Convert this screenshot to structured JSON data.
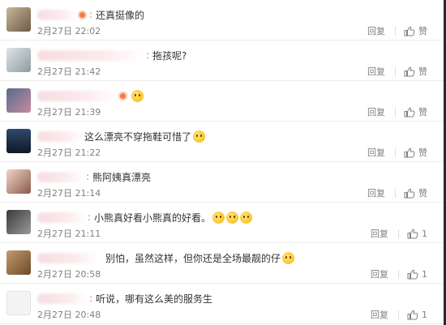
{
  "comments": [
    {
      "id": 1,
      "text": "还真挺像的",
      "time": "2月27日 22:02",
      "reply": "回复",
      "like": "赞"
    },
    {
      "id": 2,
      "text": "拖孩呢?",
      "time": "2月27日 21:42",
      "reply": "回复",
      "like": "赞"
    },
    {
      "id": 3,
      "text": "",
      "time": "2月27日 21:39",
      "reply": "回复",
      "like": "赞"
    },
    {
      "id": 4,
      "text": "这么漂亮不穿拖鞋可惜了",
      "time": "2月27日 21:22",
      "reply": "回复",
      "like": "赞"
    },
    {
      "id": 5,
      "text": "熊阿姨真漂亮",
      "time": "2月27日 21:14",
      "reply": "回复",
      "like": "赞"
    },
    {
      "id": 6,
      "text": "小熊真好看小熊真的好看。",
      "time": "2月27日 21:11",
      "reply": "回复",
      "like": "1"
    },
    {
      "id": 7,
      "text": "别怕，虽然这样，但你还是全场最靓的仔",
      "time": "2月27日 20:58",
      "reply": "回复",
      "like": "1"
    },
    {
      "id": 8,
      "text": "听说，哪有这么美的服务生",
      "time": "2月27日 20:48",
      "reply": "回复",
      "like": "1"
    }
  ],
  "colors": {
    "name_colon": "#eb7350",
    "meta": "#808080",
    "text": "#333333"
  },
  "icons": {
    "like": "thumb-up-icon",
    "emoji": "emoji-icon",
    "badge": "member-badge-icon"
  }
}
